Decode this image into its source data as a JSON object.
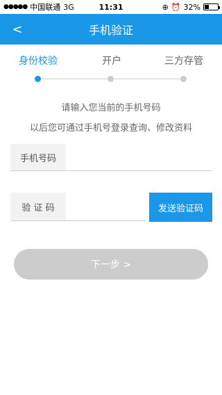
{
  "status": {
    "carrier": "中国联通",
    "network": "3G",
    "time": "11:31",
    "battery": "32%",
    "battery_level": 0.32
  },
  "nav": {
    "title": "手机验证",
    "back": "<"
  },
  "steps": [
    {
      "label": "身份校验",
      "active": true
    },
    {
      "label": "开户",
      "active": false
    },
    {
      "label": "三方存管",
      "active": false
    }
  ],
  "hint": {
    "line1": "请输入您当前的手机号码",
    "line2": "以后您可通过手机号登录查询、修改资料"
  },
  "form": {
    "phone_label": "手机号码",
    "phone_value": "",
    "code_label": "验 证 码",
    "code_value": "",
    "send_button": "发送验证码"
  },
  "next_button": "下一步 >",
  "colors": {
    "accent": "#1a97e6",
    "disabled": "#cccccc"
  }
}
